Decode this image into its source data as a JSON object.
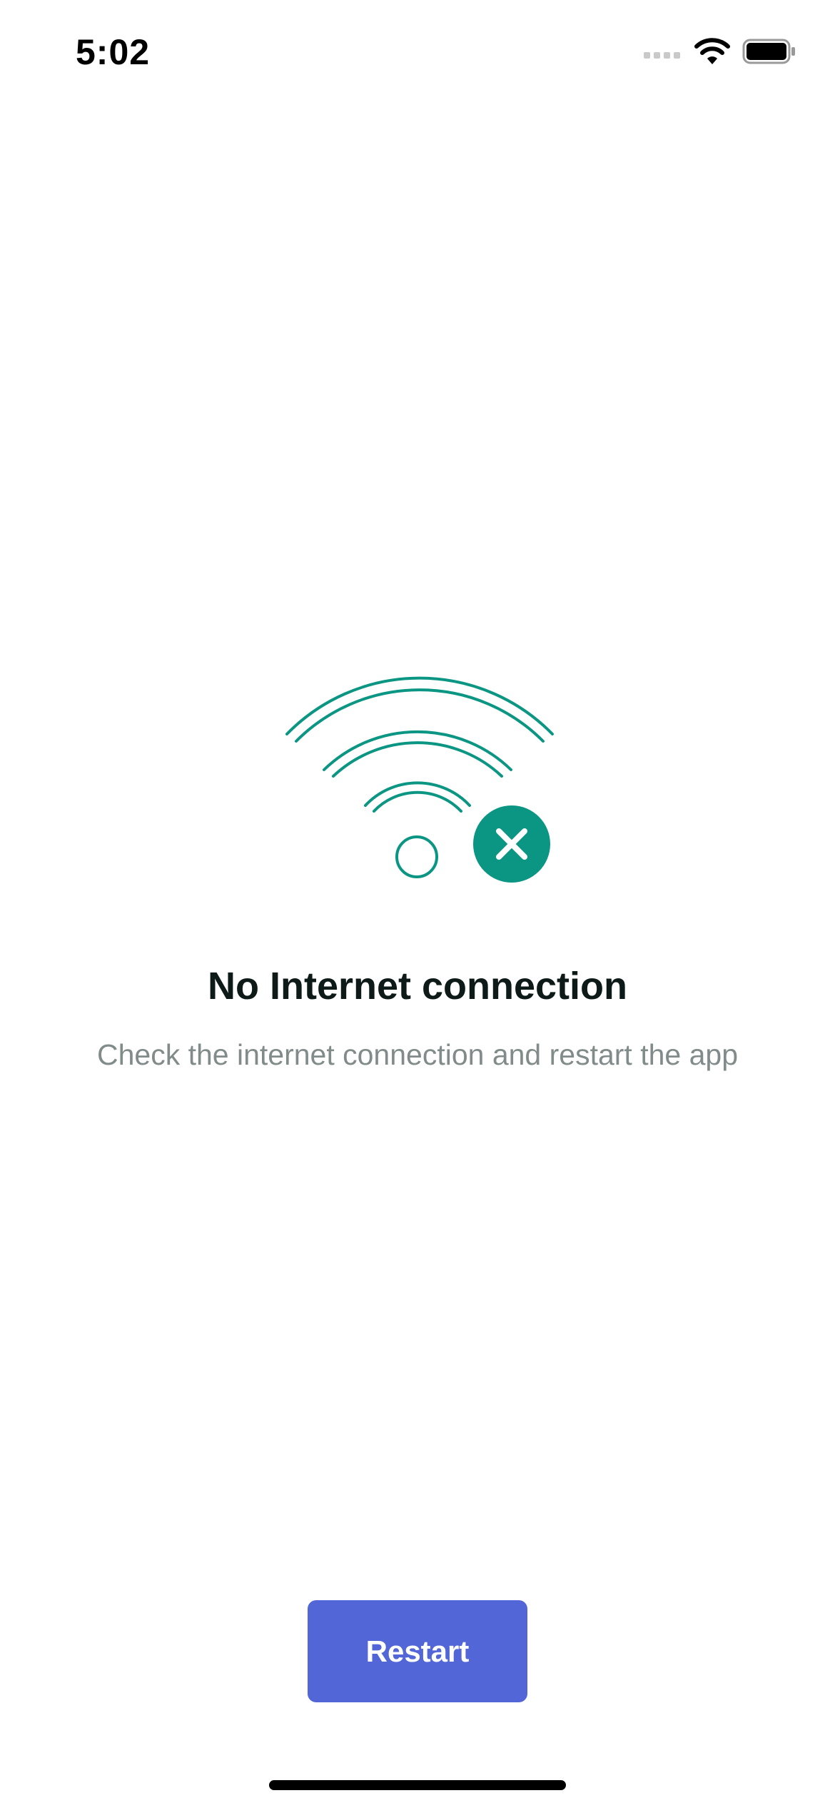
{
  "status_bar": {
    "time": "5:02",
    "icons": [
      "cellular-signal-icon",
      "wifi-icon",
      "battery-icon"
    ]
  },
  "illustration": {
    "icon": "wifi-off-icon",
    "color": "#0a9683"
  },
  "message": {
    "title": "No Internet connection",
    "subtitle": "Check the internet connection and restart the app"
  },
  "actions": {
    "restart_label": "Restart",
    "button_color": "#5266d7"
  }
}
